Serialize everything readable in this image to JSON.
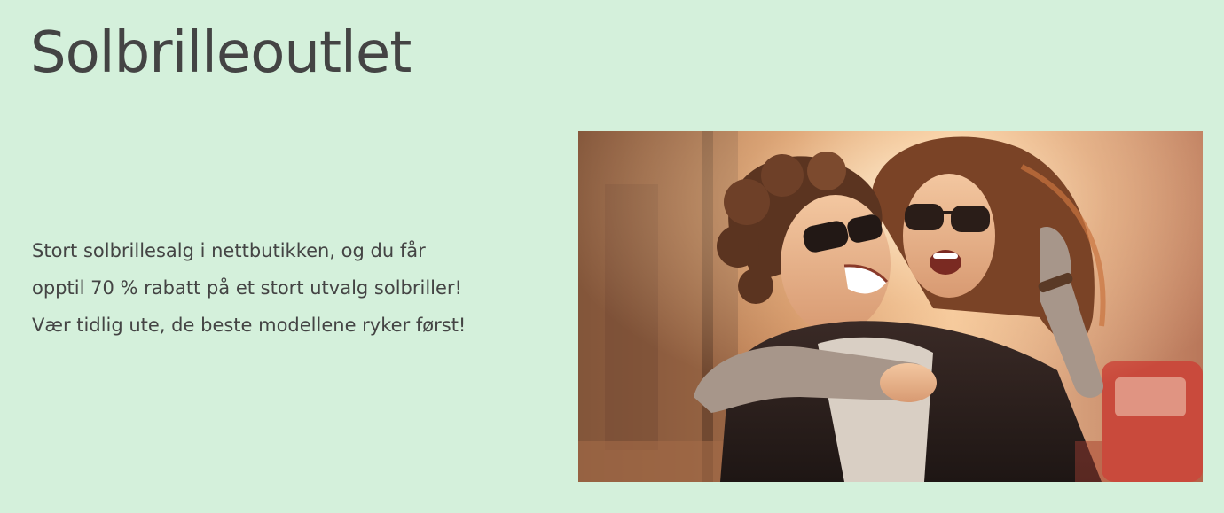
{
  "colors": {
    "background": "#d4f0db",
    "text": "#444444"
  },
  "hero": {
    "title": "Solbrilleoutlet",
    "description_lines": [
      "Stort solbrillesalg i nettbutikken, og du får",
      "opptil 70 % rabatt på et stort utvalg solbriller!",
      "Vær tidlig ute, de beste modellene ryker først!"
    ],
    "image_subject": "couple-in-sunglasses-photo"
  }
}
